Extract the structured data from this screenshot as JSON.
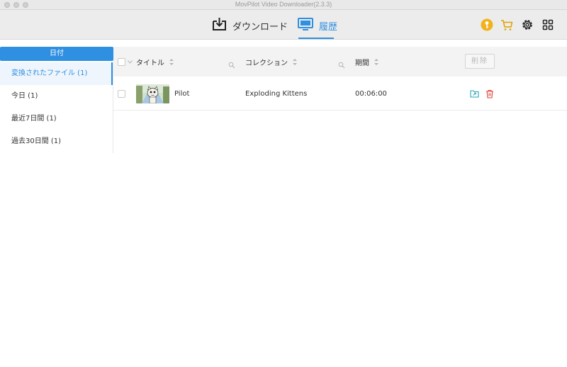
{
  "window": {
    "title": "MovPilot Video Downloader(2.3.3)"
  },
  "toolbar": {
    "tabs": [
      {
        "label": "ダウンロード",
        "icon": "download-icon",
        "active": false
      },
      {
        "label": "履歴",
        "icon": "monitor-icon",
        "active": true
      }
    ],
    "icons": [
      "key-icon",
      "cart-icon",
      "gear-icon",
      "grid-icon"
    ]
  },
  "sidebar": {
    "header": "日付",
    "items": [
      {
        "label": "変換されたファイル (1)",
        "active": true
      },
      {
        "label": "今日 (1)",
        "active": false
      },
      {
        "label": "最近7日間 (1)",
        "active": false
      },
      {
        "label": "過去30日間 (1)",
        "active": false
      }
    ]
  },
  "table": {
    "columns": {
      "title": "タイトル",
      "collection": "コレクション",
      "duration": "期間"
    },
    "delete_label": "削除",
    "rows": [
      {
        "title": "Pilot",
        "collection": "Exploding Kittens",
        "duration": "00:06:00"
      }
    ]
  },
  "colors": {
    "accent": "#2f8fe0",
    "delete_red": "#e0403a",
    "folder_teal": "#27a3b4",
    "key_gold": "#f3b21b"
  }
}
